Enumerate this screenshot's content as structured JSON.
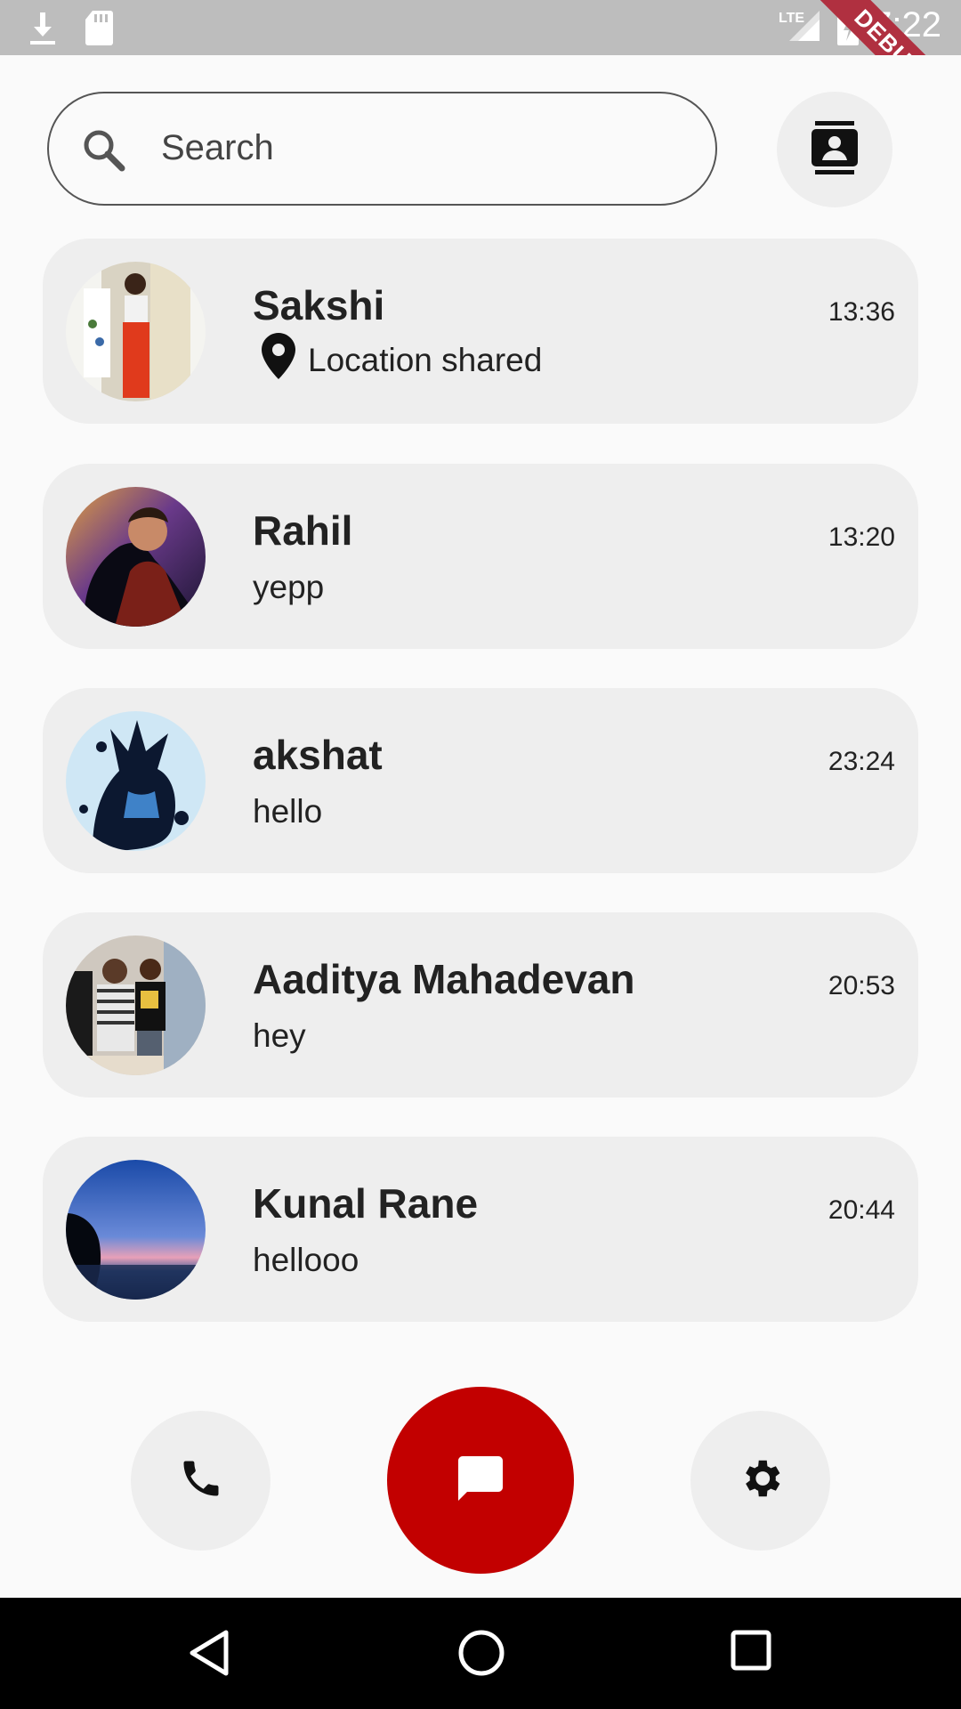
{
  "status_bar": {
    "time": "7:22",
    "network": "LTE",
    "debug_banner": "DEBUG"
  },
  "search": {
    "placeholder": "Search"
  },
  "chats": [
    {
      "name": "Sakshi",
      "message": "Location shared",
      "time": "13:36"
    },
    {
      "name": "Rahil",
      "message": "yepp",
      "time": "13:20"
    },
    {
      "name": "akshat",
      "message": "hello",
      "time": "23:24"
    },
    {
      "name": "Aaditya Mahadevan",
      "message": "hey",
      "time": "20:53"
    },
    {
      "name": "Kunal Rane",
      "message": "hellooo",
      "time": "20:44"
    }
  ],
  "colors": {
    "accent": "#c20000",
    "card": "#eeeeee",
    "background": "#fafafa"
  },
  "icons": {
    "search": "search-icon",
    "contacts": "contacts-icon",
    "location": "location-pin-icon",
    "phone": "phone-icon",
    "chat": "chat-icon",
    "settings": "gear-icon"
  }
}
